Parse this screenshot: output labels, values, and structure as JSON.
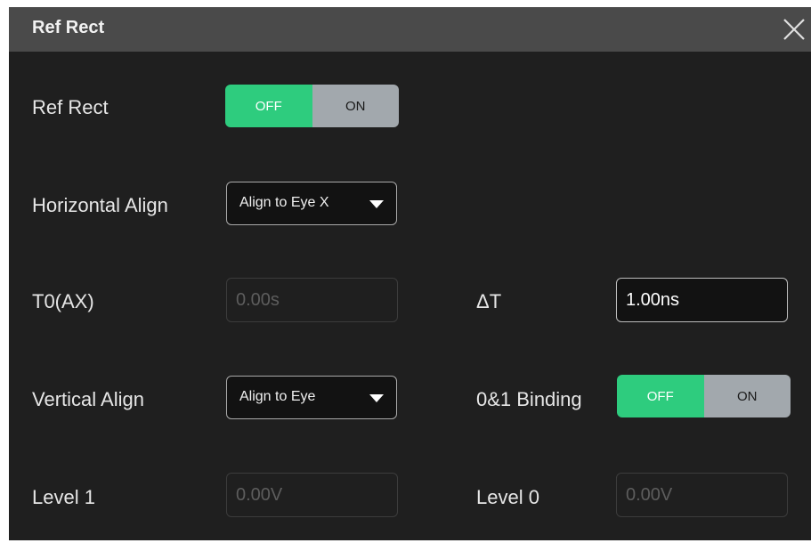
{
  "dialog": {
    "title": "Ref Rect",
    "close_icon": "close-icon"
  },
  "ref_rect": {
    "label": "Ref Rect",
    "off_label": "OFF",
    "on_label": "ON",
    "state": "OFF"
  },
  "horizontal_align": {
    "label": "Horizontal Align",
    "value": "Align to Eye X"
  },
  "t0": {
    "label": "T0(AX)",
    "value": "0.00s"
  },
  "delta_t": {
    "label": "ΔT",
    "value": "1.00ns"
  },
  "vertical_align": {
    "label": "Vertical Align",
    "value": "Align to Eye"
  },
  "binding": {
    "label": "0&1 Binding",
    "off_label": "OFF",
    "on_label": "ON",
    "state": "OFF"
  },
  "level1": {
    "label": "Level 1",
    "value": "0.00V"
  },
  "level0": {
    "label": "Level 0",
    "value": "0.00V"
  },
  "colors": {
    "accent_green": "#2ecc7e",
    "toggle_gray": "#a2a8ad",
    "panel_bg": "#1f1f1f",
    "titlebar_bg": "#4a4a4a"
  }
}
